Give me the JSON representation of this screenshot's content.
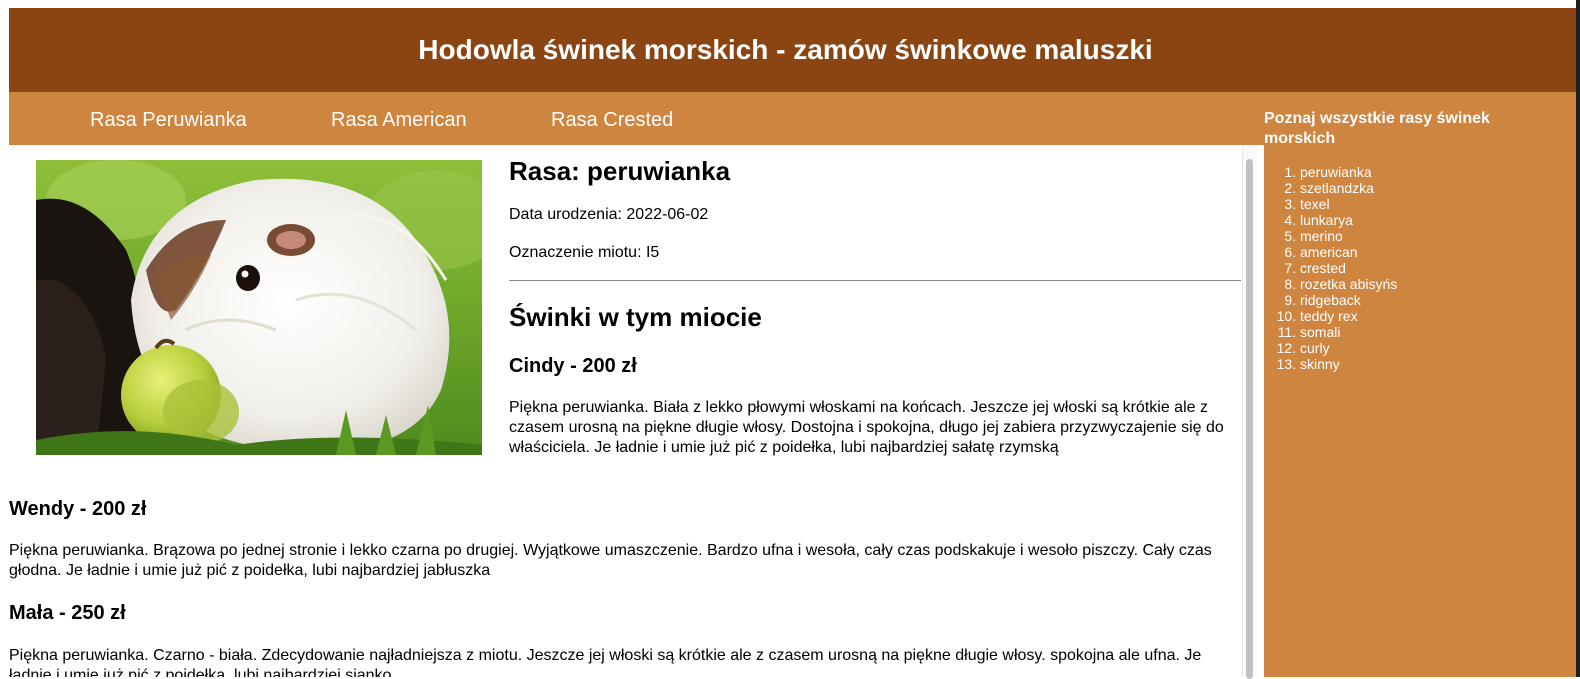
{
  "header": {
    "title": "Hodowla świnek morskich - zamów świnkowe maluszki"
  },
  "nav": {
    "items": [
      "Rasa Peruwianka",
      "Rasa American",
      "Rasa Crested"
    ]
  },
  "sidebar": {
    "heading": "Poznaj wszystkie rasy świnek morskich",
    "breeds": [
      "peruwianka",
      "szetlandzka",
      "texel",
      "lunkarya",
      "merino",
      "american",
      "crested",
      "rozetka abisyńs",
      "ridgeback",
      "teddy rex",
      "somali",
      "curly",
      "skinny"
    ]
  },
  "main": {
    "breed_title": "Rasa: peruwianka",
    "birth_date": "Data urodzenia: 2022-06-02",
    "litter_mark": "Oznaczenie miotu: I5",
    "litter_heading": "Świnki w tym miocie",
    "pigs": [
      {
        "name": "Cindy - 200 zł",
        "description": "Piękna peruwianka. Biała z lekko płowymi włoskami na końcach. Jeszcze jej włoski są krótkie ale z czasem urosną na piękne długie włosy. Dostojna i spokojna, długo jej zabiera przyzwyczajenie się do właściciela. Je ładnie i umie już pić z poidełka, lubi najbardziej sałatę rzymską"
      },
      {
        "name": "Wendy - 200 zł",
        "description": "Piękna peruwianka. Brązowa po jednej stronie i lekko czarna po drugiej. Wyjątkowe umaszczenie. Bardzo ufna i wesoła, cały czas podskakuje i wesoło piszczy. Cały czas głodna. Je ładnie i umie już pić z poidełka, lubi najbardziej jabłuszka"
      },
      {
        "name": "Mała - 250 zł",
        "description": "Piękna peruwianka. Czarno - biała. Zdecydowanie najładniejsza z miotu. Jeszcze jej włoski są krótkie ale z czasem urosną na piękne długie włosy. spokojna ale ufna. Je ładnie i umie już pić z poidełka, lubi najbardziej sianko."
      }
    ]
  },
  "colors": {
    "header_bg": "#8b4513",
    "nav_bg": "#cd853f"
  }
}
